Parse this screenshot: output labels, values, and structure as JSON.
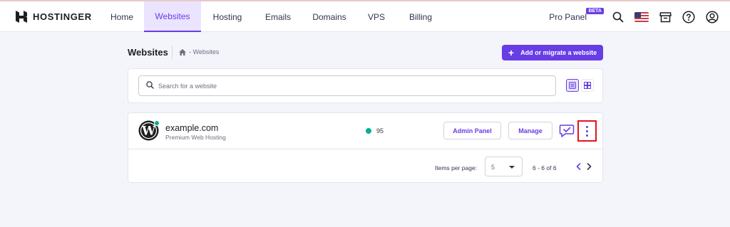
{
  "brand": {
    "name": "HOSTINGER"
  },
  "nav": {
    "items": [
      {
        "label": "Home",
        "active": false
      },
      {
        "label": "Websites",
        "active": true
      },
      {
        "label": "Hosting",
        "active": false
      },
      {
        "label": "Emails",
        "active": false
      },
      {
        "label": "Domains",
        "active": false
      },
      {
        "label": "VPS",
        "active": false
      },
      {
        "label": "Billing",
        "active": false
      }
    ]
  },
  "toolbar": {
    "pro_panel_label": "Pro Panel",
    "beta_badge": "BETA",
    "icons": [
      "search-icon",
      "us-flag-icon",
      "store-icon",
      "help-icon",
      "account-icon"
    ]
  },
  "page": {
    "title": "Websites",
    "breadcrumb": "- Websites",
    "add_button_label": "Add or migrate a website"
  },
  "search": {
    "placeholder": "Search for a website",
    "value": ""
  },
  "sites": [
    {
      "domain": "example.com",
      "plan": "Premium Web Hosting",
      "score": "95",
      "admin_label": "Admin Panel",
      "manage_label": "Manage"
    }
  ],
  "pagination": {
    "items_per_page_label": "Items per page:",
    "items_per_page_value": "5",
    "range_text": "6 - 6 of 6"
  },
  "colors": {
    "accent": "#673de6",
    "accent_light": "#ebe4ff",
    "status_green": "#00b090",
    "highlight_red": "#e3131b"
  }
}
